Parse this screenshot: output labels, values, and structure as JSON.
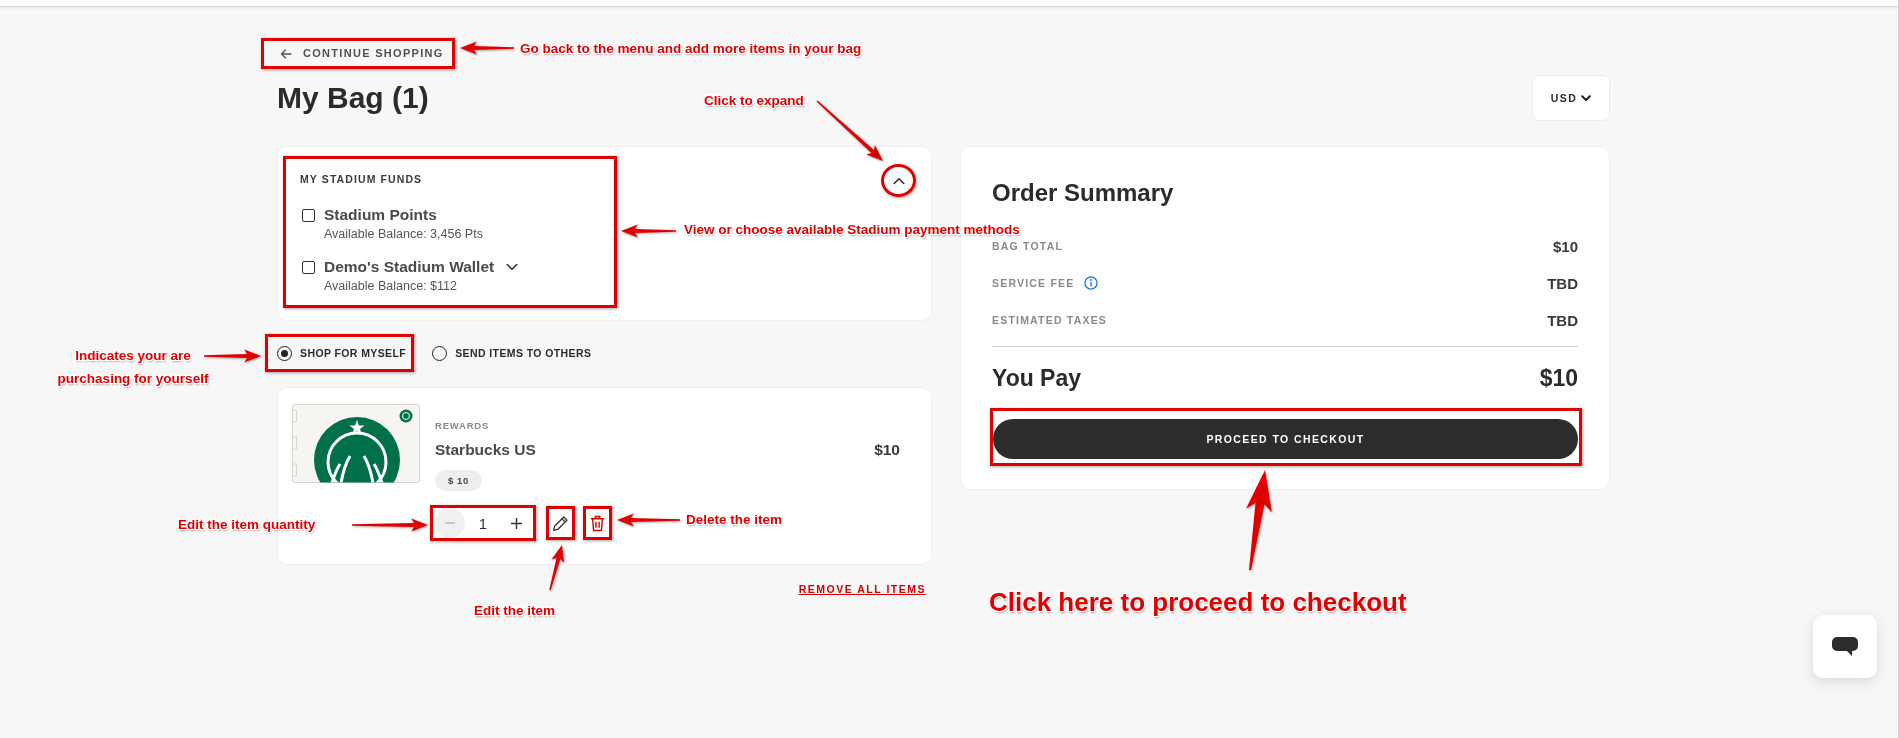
{
  "header": {
    "back_link": "CONTINUE SHOPPING",
    "title": "My Bag (1)",
    "currency": "USD"
  },
  "funds": {
    "heading": "MY STADIUM FUNDS",
    "expanded": true,
    "items": [
      {
        "name": "Stadium Points",
        "balance": "Available Balance: 3,456 Pts",
        "checked": false,
        "dropdown": false
      },
      {
        "name": "Demo's Stadium Wallet",
        "balance": "Available Balance: $112",
        "checked": false,
        "dropdown": true
      }
    ]
  },
  "recipients": [
    {
      "label": "SHOP FOR MYSELF",
      "selected": true
    },
    {
      "label": "SEND ITEMS TO OTHERS",
      "selected": false
    }
  ],
  "bag_items": [
    {
      "category": "REWARDS",
      "name": "Starbucks US",
      "price": "$10",
      "amount": "$ 10",
      "quantity": "1",
      "decrement_disabled": true
    }
  ],
  "remove_all": "REMOVE ALL ITEMS",
  "summary": {
    "title": "Order Summary",
    "lines": [
      {
        "label": "BAG TOTAL",
        "value": "$10",
        "info": false
      },
      {
        "label": "SERVICE FEE",
        "value": "TBD",
        "info": true
      },
      {
        "label": "ESTIMATED TAXES",
        "value": "TBD",
        "info": false
      }
    ],
    "total_label": "You Pay",
    "total_value": "$10",
    "checkout_button": "PROCEED TO CHECKOUT"
  },
  "annotations": [
    {
      "text": "Go back to the menu and add more items in your bag"
    },
    {
      "text": "Click to expand"
    },
    {
      "text": "View or choose available Stadium payment methods"
    },
    {
      "text": "Indicates your are purchasing for yourself"
    },
    {
      "text": "Edit the item quantity"
    },
    {
      "text": "Delete the item"
    },
    {
      "text": "Edit the item"
    },
    {
      "text": "Click here to proceed to checkout"
    }
  ]
}
